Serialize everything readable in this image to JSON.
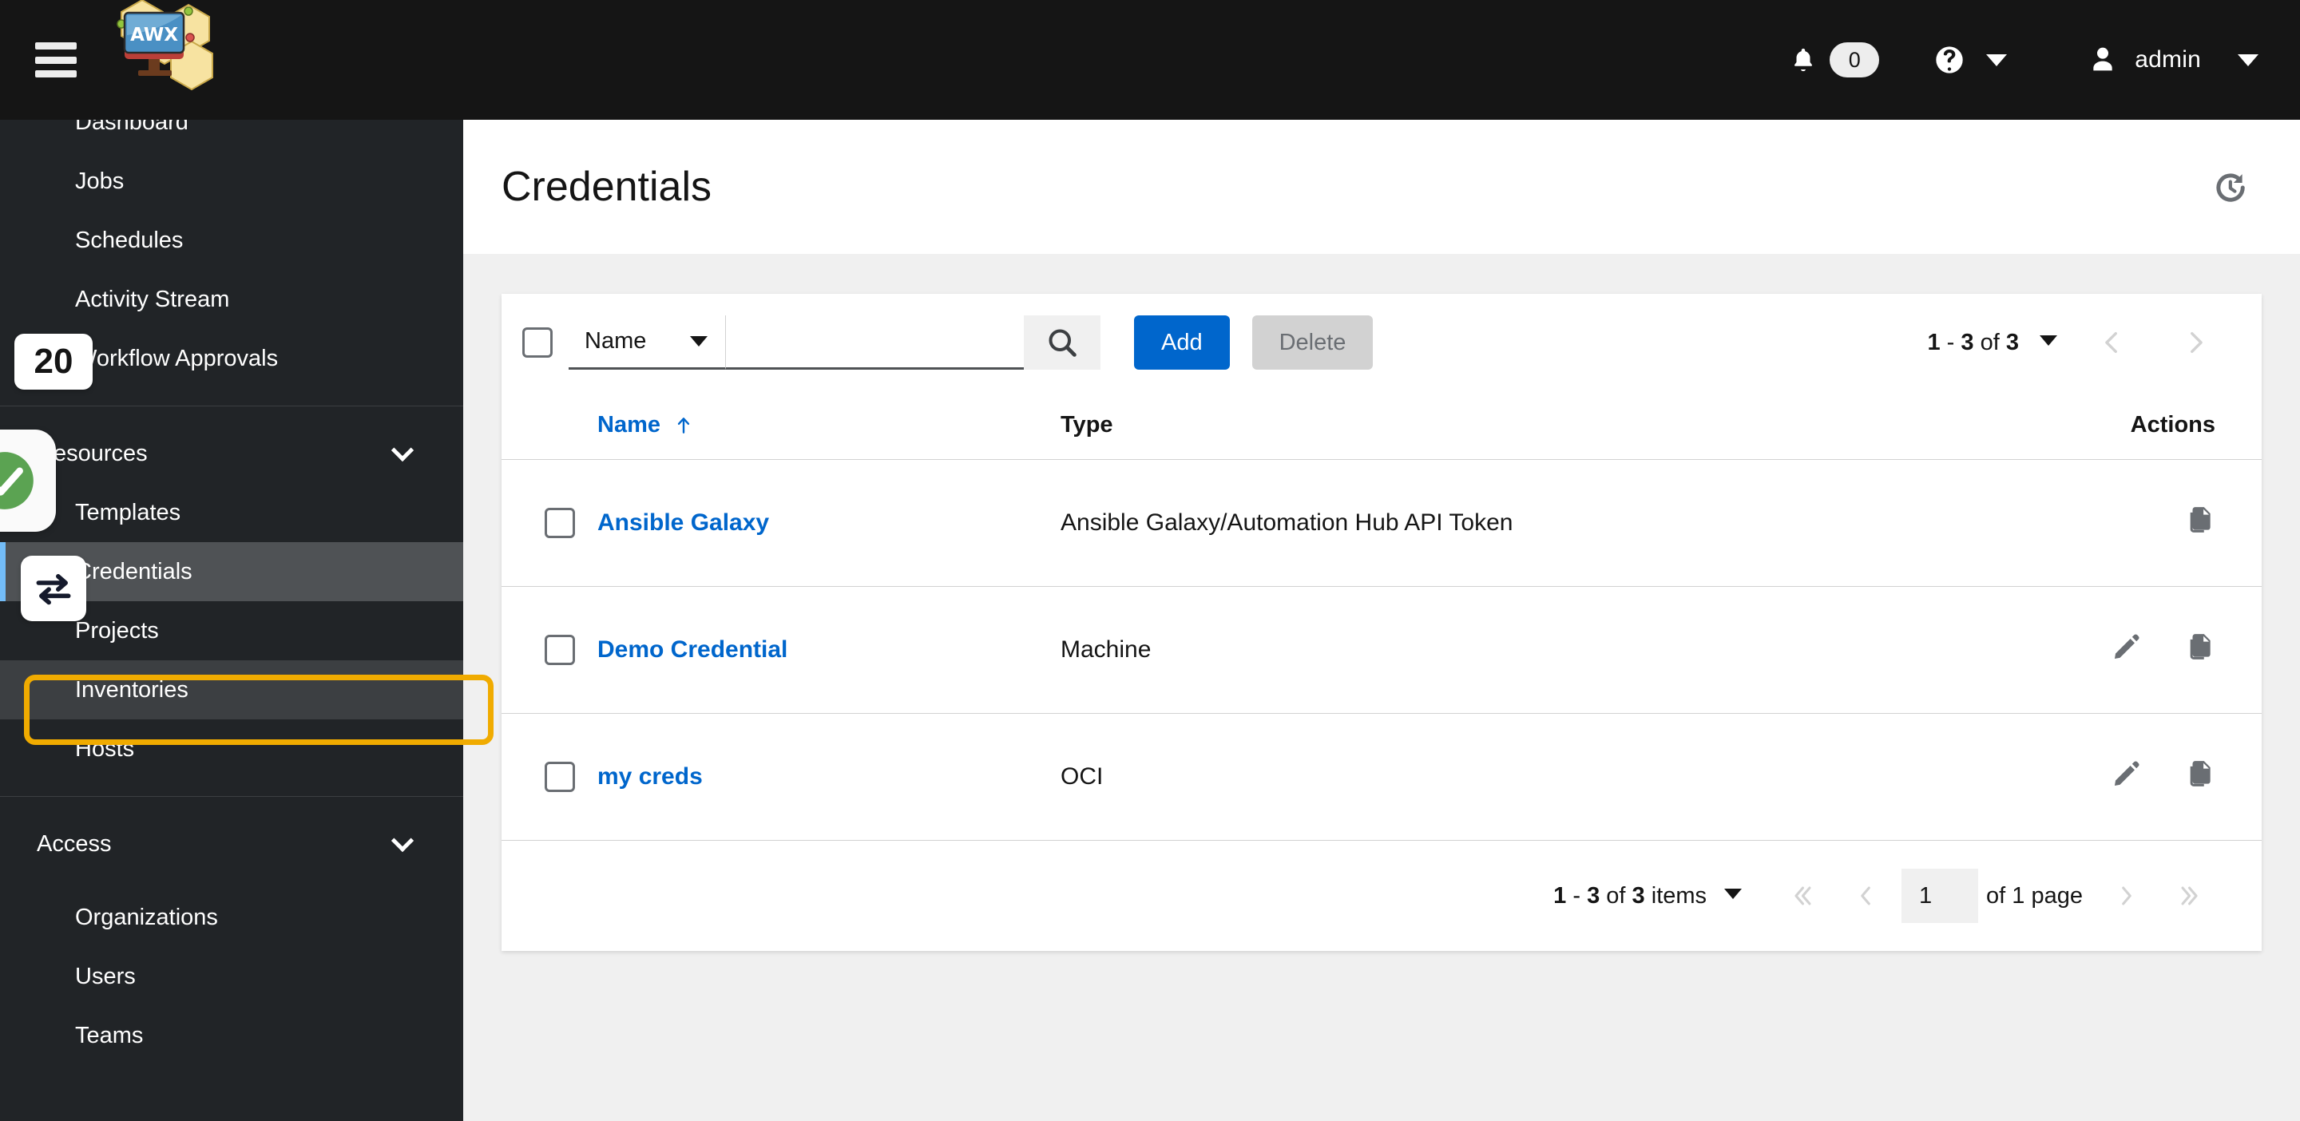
{
  "masthead": {
    "menu_icon": "hamburger-icon",
    "logo_text": "AWX",
    "notifications": {
      "icon": "bell-icon",
      "count": "0"
    },
    "help": {
      "icon": "question-circle-icon",
      "caret": "caret-down-icon"
    },
    "user": {
      "icon": "user-icon",
      "name": "admin",
      "caret": "caret-down-icon"
    }
  },
  "sidebar": {
    "items": [
      {
        "label": "Dashboard",
        "type": "link",
        "state": "normal"
      },
      {
        "label": "Jobs",
        "type": "link",
        "state": "normal"
      },
      {
        "label": "Schedules",
        "type": "link",
        "state": "normal"
      },
      {
        "label": "Activity Stream",
        "type": "link",
        "state": "normal"
      },
      {
        "label": "Workflow Approvals",
        "type": "link",
        "state": "normal"
      }
    ],
    "groups": [
      {
        "label": "Resources",
        "expanded": true,
        "items": [
          {
            "label": "Templates",
            "state": "normal"
          },
          {
            "label": "Credentials",
            "state": "active"
          },
          {
            "label": "Projects",
            "state": "normal"
          },
          {
            "label": "Inventories",
            "state": "hovered"
          },
          {
            "label": "Hosts",
            "state": "normal"
          }
        ]
      },
      {
        "label": "Access",
        "expanded": true,
        "items": [
          {
            "label": "Organizations",
            "state": "normal"
          },
          {
            "label": "Users",
            "state": "normal"
          },
          {
            "label": "Teams",
            "state": "normal"
          }
        ]
      }
    ]
  },
  "page": {
    "title": "Credentials",
    "history_icon": "history-icon"
  },
  "toolbar": {
    "select_all_checkbox": "unchecked",
    "filter_select": {
      "value": "Name",
      "caret": "caret-down-icon"
    },
    "search": {
      "value": "",
      "placeholder": "",
      "icon": "search-icon"
    },
    "add_label": "Add",
    "delete_label": "Delete",
    "pagination": {
      "summary": "1 - 3 of 3",
      "range_start": "1",
      "range_end": "3",
      "total": "3",
      "caret": "caret-down-icon",
      "prev_icon": "chevron-left-icon",
      "next_icon": "chevron-right-icon",
      "prev_disabled": true,
      "next_disabled": true
    }
  },
  "table": {
    "columns": [
      {
        "key": "name",
        "label": "Name",
        "sorted": true,
        "sort_icon": "arrow-up-icon"
      },
      {
        "key": "type",
        "label": "Type",
        "sorted": false
      },
      {
        "key": "actions",
        "label": "Actions",
        "sorted": false
      }
    ],
    "rows": [
      {
        "name": "Ansible Galaxy",
        "type": "Ansible Galaxy/Automation Hub API Token",
        "checked": false,
        "actions": [
          "copy-icon"
        ]
      },
      {
        "name": "Demo Credential",
        "type": "Machine",
        "checked": false,
        "actions": [
          "edit-pencil-icon",
          "copy-icon"
        ]
      },
      {
        "name": "my creds",
        "type": "OCI",
        "checked": false,
        "actions": [
          "edit-pencil-icon",
          "copy-icon"
        ]
      }
    ]
  },
  "bottom_pagination": {
    "items_label": "1 - 3 of 3 items",
    "range_start": "1",
    "range_end": "3",
    "total": "3",
    "items_word": "items",
    "caret": "caret-down-icon",
    "first_icon": "angle-double-left-icon",
    "prev_icon": "angle-left-icon",
    "page_value": "1",
    "of_page_label": "of 1 page",
    "next_icon": "angle-right-icon",
    "last_icon": "angle-double-right-icon"
  },
  "overlays": {
    "step_badge": "20",
    "status_icon": "check-circle-icon",
    "action_icon": "swap-arrows-icon",
    "highlight_target": "Inventories",
    "highlight_color": "#f0ab00"
  },
  "colors": {
    "masthead_bg": "#151515",
    "sidebar_bg": "#212427",
    "page_bg": "#f0f0f0",
    "primary_button": "#0066cc",
    "link": "#0066cc",
    "active_nav": "#4f5255",
    "active_marker": "#73bcf7",
    "success_green": "#5ba352",
    "annotation_orange": "#f0ab00"
  }
}
